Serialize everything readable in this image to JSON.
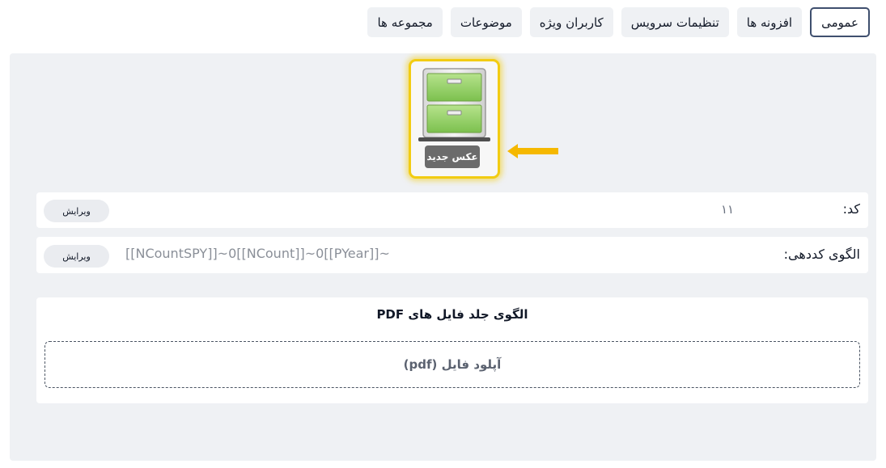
{
  "tabs": [
    {
      "label": "عمومی",
      "active": true
    },
    {
      "label": "افزونه ها"
    },
    {
      "label": "تنظیمات سرویس"
    },
    {
      "label": "کاربران ویژه"
    },
    {
      "label": "موضوعات"
    },
    {
      "label": "مجموعه ها"
    }
  ],
  "image": {
    "label": "عکس جدید",
    "icon": "file-cabinet-icon",
    "highlight_color": "#f2cc12",
    "arrow_color": "#f5b800"
  },
  "code_row": {
    "label": "کد:",
    "value": "۱۱",
    "edit_label": "ویرایش"
  },
  "pattern_row": {
    "label": "الگوی کددهی:",
    "value": "[[NCountSPY]]~0[[NCount]]~0[[PYear]]~",
    "edit_label": "ویرایش"
  },
  "pdf_cover": {
    "title": "الگوی جلد فایل های PDF",
    "upload_label": "آپلود فایل (pdf)"
  }
}
